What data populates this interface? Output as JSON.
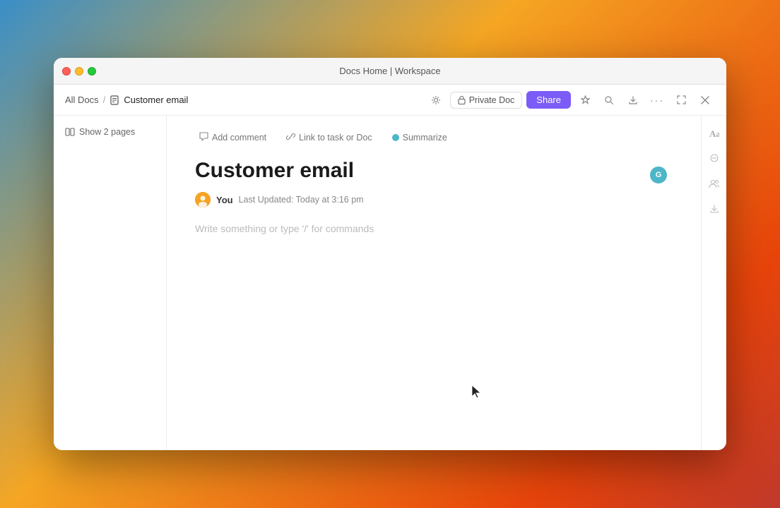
{
  "window": {
    "title": "Docs Home | Workspace"
  },
  "titlebar": {
    "title": "Docs Home | Workspace",
    "traffic_lights": [
      "red",
      "yellow",
      "green"
    ]
  },
  "toolbar": {
    "breadcrumb": {
      "all_docs_label": "All Docs",
      "separator": "/",
      "current_label": "Customer email"
    },
    "private_doc_label": "Private Doc",
    "share_label": "Share"
  },
  "sidebar": {
    "show_pages_label": "Show 2 pages"
  },
  "doc_toolbar": {
    "add_comment_label": "Add comment",
    "link_task_label": "Link to task or Doc",
    "summarize_label": "Summarize"
  },
  "document": {
    "title": "Customer email",
    "author": "You",
    "last_updated": "Last Updated: Today at 3:16 pm",
    "placeholder": "Write something or type '/' for commands"
  },
  "right_sidebar": {
    "icons": [
      "format",
      "expand",
      "share-users",
      "download"
    ]
  },
  "colors": {
    "accent_purple": "#7b5cf6",
    "accent_teal": "#4db6c8",
    "border": "#ebebeb"
  }
}
